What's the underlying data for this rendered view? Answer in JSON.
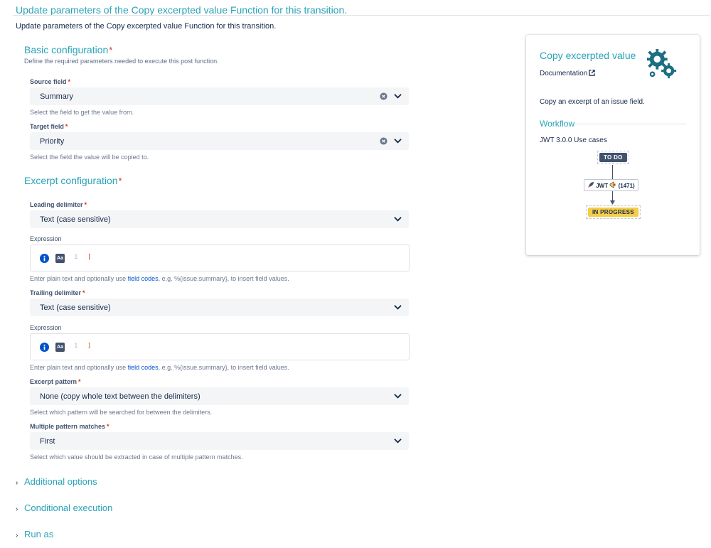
{
  "header": {
    "title": "Update parameters of the Copy excerpted value Function for this transition.",
    "description": "Update parameters of the Copy excerpted value Function for this transition."
  },
  "basic": {
    "title": "Basic configuration",
    "required_mark": "*",
    "subtitle": "Define the required parameters needed to execute this post function.",
    "source": {
      "label": "Source field",
      "value": "Summary",
      "help": "Select the field to get the value from."
    },
    "target": {
      "label": "Target field",
      "value": "Priority",
      "help": "Select the field the value will be copied to."
    }
  },
  "excerpt": {
    "title": "Excerpt configuration",
    "leading": {
      "label": "Leading delimiter",
      "value": "Text (case sensitive)",
      "expr_label": "Expression",
      "line_no": "1",
      "code": "[",
      "help_pre": "Enter plain text and optionally use ",
      "help_link": "field codes",
      "help_post": ", e.g. %{issue.summary}, to insert field values."
    },
    "trailing": {
      "label": "Trailing delimiter",
      "value": "Text (case sensitive)",
      "expr_label": "Expression",
      "line_no": "1",
      "code": "]",
      "help_pre": "Enter plain text and optionally use ",
      "help_link": "field codes",
      "help_post": ", e.g. %{issue.summary}, to insert field values."
    },
    "pattern": {
      "label": "Excerpt pattern",
      "value": "None (copy whole text between the delimiters)",
      "help": "Select which pattern will be searched for between the delimiters."
    },
    "multiple": {
      "label": "Multiple pattern matches",
      "value": "First",
      "help": "Select which value should be extracted in case of multiple pattern matches."
    }
  },
  "collapsibles": {
    "additional": "Additional options",
    "conditional": "Conditional execution",
    "run_as": "Run as"
  },
  "side": {
    "title": "Copy excerpted value",
    "documentation": "Documentation",
    "description": "Copy an excerpt of an issue field.",
    "workflow_title": "Workflow",
    "workflow_name": "JWT 3.0.0 Use cases",
    "status_from": "TO DO",
    "transition": "JWT",
    "transition_id": "(1471)",
    "status_to": "IN PROGRESS"
  },
  "icons": {
    "clear": "clear-icon",
    "chevron": "chevron-down-icon",
    "info": "info-icon",
    "case": "case-sensitive-icon",
    "external": "external-link-icon",
    "gears": "gears-icon",
    "rocket": "rocket-icon",
    "megaphone": "megaphone-icon",
    "caret": "chevron-right-icon"
  },
  "colors": {
    "accent": "#2aa3b8",
    "required": "#de350b",
    "link": "#0052cc",
    "status_todo": "#42526e",
    "status_inprogress": "#f5cd47"
  }
}
